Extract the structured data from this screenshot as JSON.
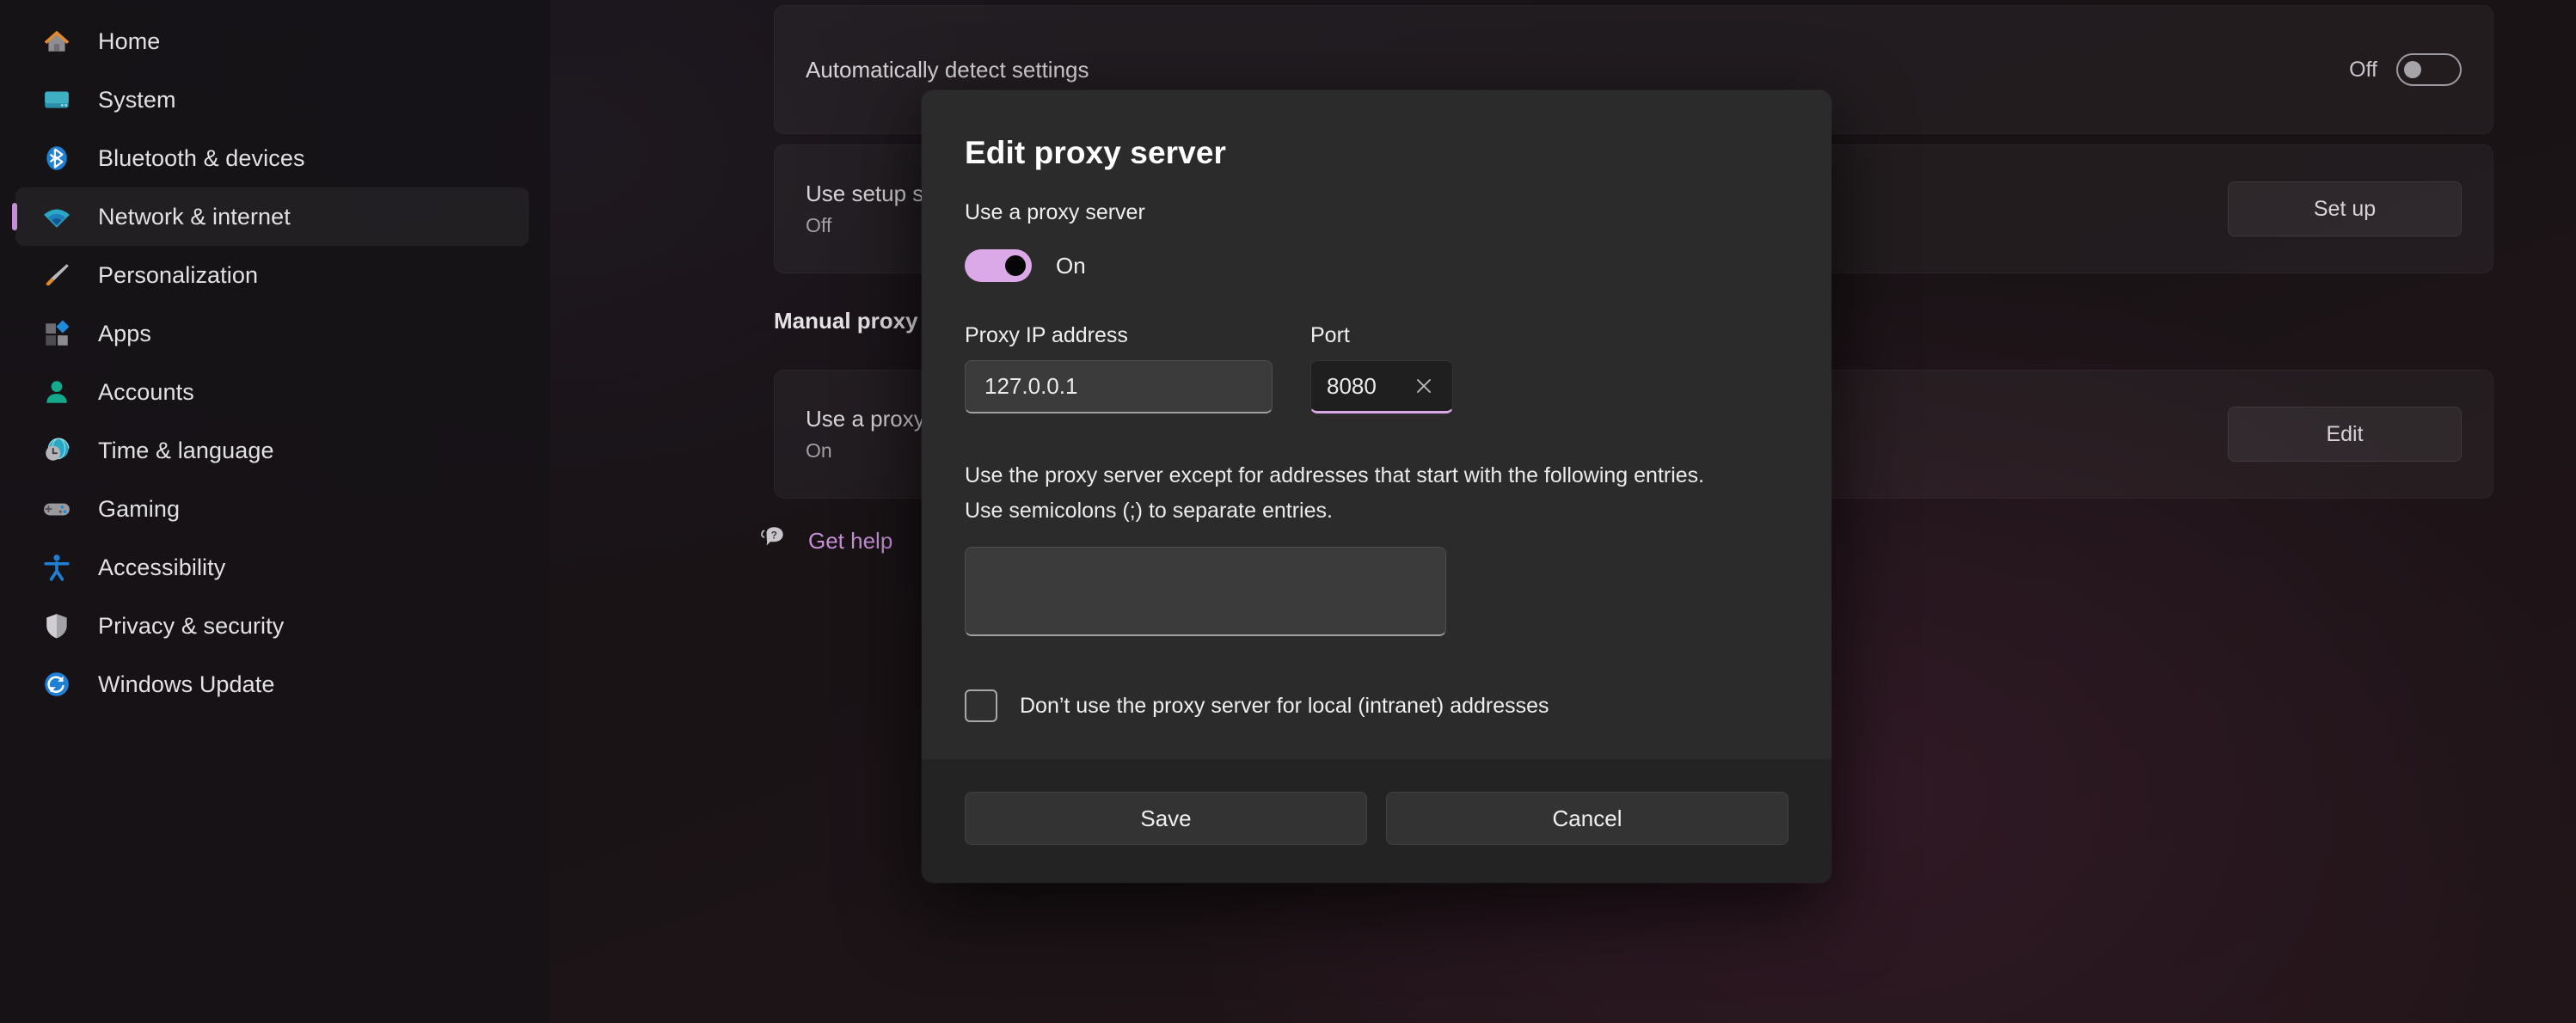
{
  "sidebar": {
    "items": [
      {
        "label": "Home",
        "icon": "home-icon",
        "active": false
      },
      {
        "label": "System",
        "icon": "system-icon",
        "active": false
      },
      {
        "label": "Bluetooth & devices",
        "icon": "bluetooth-icon",
        "active": false
      },
      {
        "label": "Network & internet",
        "icon": "network-wifi-icon",
        "active": true
      },
      {
        "label": "Personalization",
        "icon": "paintbrush-icon",
        "active": false
      },
      {
        "label": "Apps",
        "icon": "apps-icon",
        "active": false
      },
      {
        "label": "Accounts",
        "icon": "accounts-person-icon",
        "active": false
      },
      {
        "label": "Time & language",
        "icon": "clock-globe-icon",
        "active": false
      },
      {
        "label": "Gaming",
        "icon": "gamepad-icon",
        "active": false
      },
      {
        "label": "Accessibility",
        "icon": "accessibility-icon",
        "active": false
      },
      {
        "label": "Privacy & security",
        "icon": "shield-icon",
        "active": false
      },
      {
        "label": "Windows Update",
        "icon": "update-refresh-icon",
        "active": false
      }
    ]
  },
  "content": {
    "auto_detect": {
      "title": "Automatically detect settings",
      "toggle_label": "Off",
      "toggle_state": "off"
    },
    "setup_script": {
      "title": "Use setup s",
      "subtitle": "Off",
      "button_label": "Set up"
    },
    "manual_section_heading": "Manual proxy",
    "manual_proxy": {
      "title": "Use a proxy",
      "subtitle": "On",
      "button_label": "Edit"
    },
    "get_help": {
      "label": "Get help",
      "icon": "help-question-icon"
    }
  },
  "dialog": {
    "title": "Edit proxy server",
    "use_proxy_label": "Use a proxy server",
    "toggle": {
      "state_label": "On",
      "state": "on"
    },
    "proxy_ip": {
      "label": "Proxy IP address",
      "value": "127.0.0.1"
    },
    "port": {
      "label": "Port",
      "value": "8080",
      "clear_icon": "close-x-icon",
      "focused": true
    },
    "exceptions": {
      "hint_line1": "Use the proxy server except for addresses that start with the following entries.",
      "hint_line2": "Use semicolons (;) to separate entries.",
      "value": "",
      "placeholder": ""
    },
    "bypass_local": {
      "label": "Don’t use the proxy server for local (intranet) addresses",
      "checked": false
    },
    "save_label": "Save",
    "cancel_label": "Cancel"
  },
  "colors": {
    "accent": "#dca9e8",
    "link": "#c58fd8",
    "dialog_bg": "#2b2b2b",
    "dialog_footer_bg": "#232323",
    "page_bg": "#17141a"
  }
}
